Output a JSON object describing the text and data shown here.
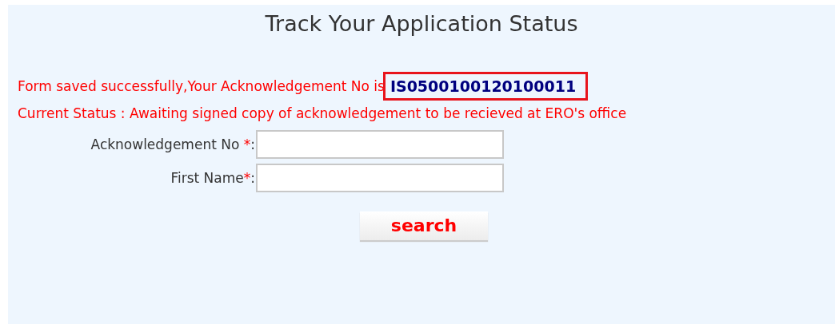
{
  "title": "Track Your Application Status",
  "saved_message": {
    "text": "Form saved successfully,Your Acknowledgement No is",
    "acknowledgement_no": "IS0500100120100011"
  },
  "status_message": "Current Status : Awaiting signed copy of acknowledgement to be recieved at ERO's office",
  "fields": [
    {
      "label": "Acknowledgement No ",
      "required_mark": "*",
      "suffix": ":"
    },
    {
      "label": "First Name",
      "required_mark": "*",
      "suffix": ":"
    }
  ],
  "search_button": "search"
}
